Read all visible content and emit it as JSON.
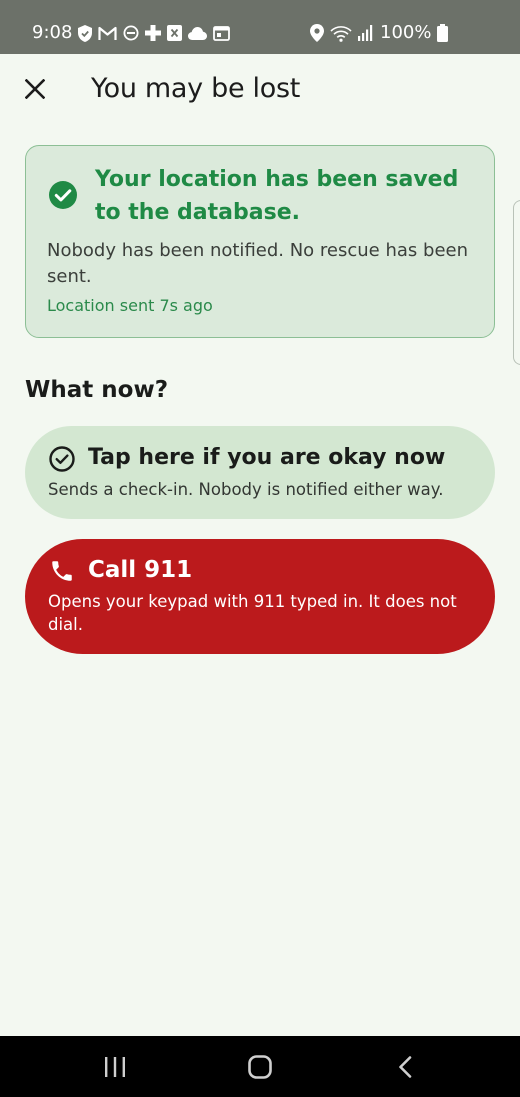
{
  "status_bar": {
    "time": "9:08",
    "battery_text": "100%",
    "left_icons": [
      "shield-icon",
      "gmail-icon",
      "do-not-disturb-icon",
      "plus-icon",
      "x-box-icon",
      "cloud-icon",
      "calendar-icon"
    ],
    "right_icons": [
      "location-icon",
      "wifi-icon",
      "signal-icon",
      "battery-icon"
    ]
  },
  "app_bar": {
    "title": "You may be lost",
    "close_icon": "close-icon"
  },
  "saved_card": {
    "heading": "Your location has been saved to the database.",
    "body": "Nobody has been notified. No rescue has been sent.",
    "meta": "Location sent 7s ago",
    "icon": "check-circle-icon"
  },
  "section": {
    "heading": "What now?"
  },
  "okay_button": {
    "label": "Tap here if you are okay now",
    "sub": "Sends a check-in. Nobody is notified either way.",
    "icon": "check-outline-icon"
  },
  "call_button": {
    "label": "Call 911",
    "sub": "Opens your keypad with 911 typed in. It does not dial.",
    "icon": "phone-icon"
  },
  "nav_bar": {
    "buttons": [
      "recent-apps-icon",
      "home-icon",
      "back-icon"
    ]
  },
  "colors": {
    "background": "#f3f8f1",
    "accent_green": "#1f8a45",
    "card_green": "#dbeadb",
    "okay_green": "#d3e7d1",
    "emergency_red": "#bb1a1c"
  }
}
